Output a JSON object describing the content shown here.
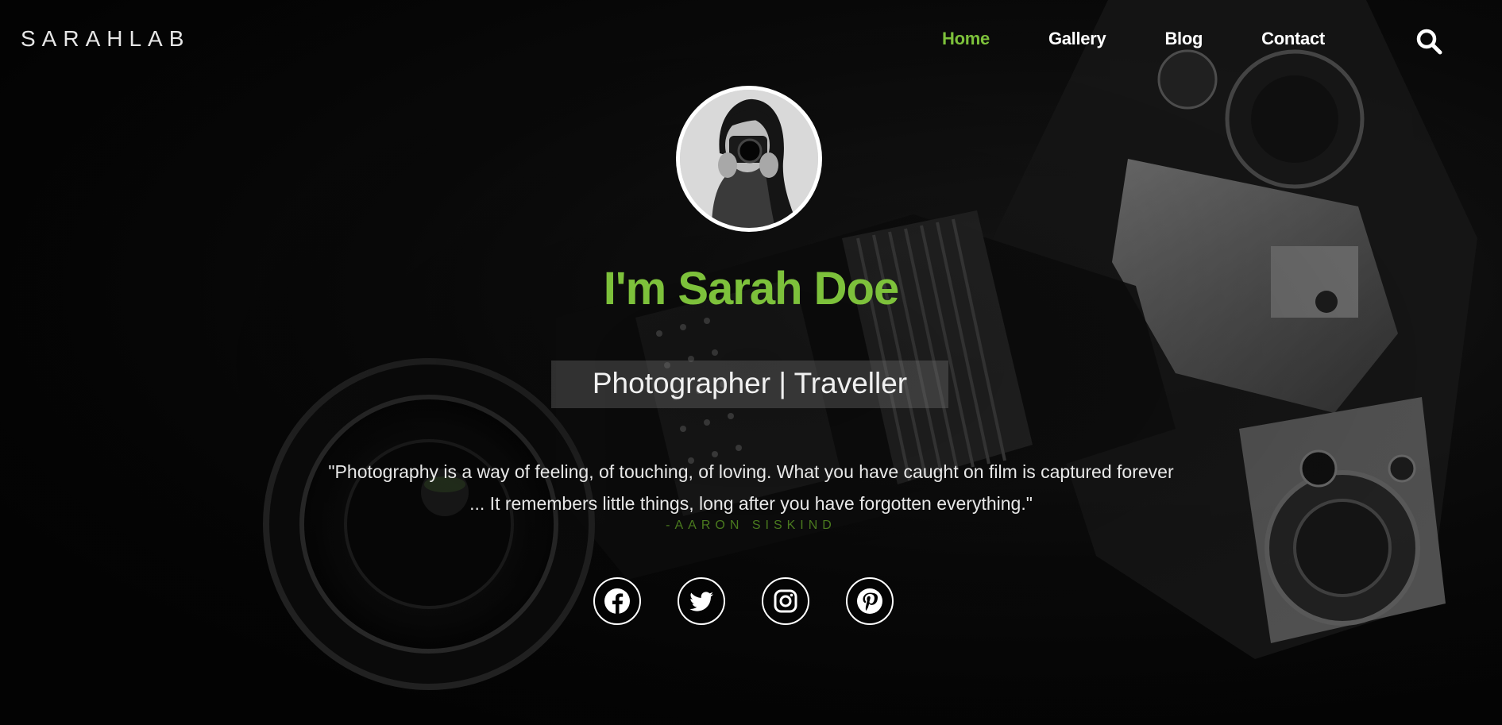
{
  "brand": {
    "logo_text": "SARAHLAB"
  },
  "nav": {
    "items": [
      {
        "label": "Home",
        "active": true
      },
      {
        "label": "Gallery",
        "active": false
      },
      {
        "label": "Blog",
        "active": false
      },
      {
        "label": "Contact",
        "active": false
      }
    ],
    "search_icon": "search-icon"
  },
  "hero": {
    "title": "I'm Sarah Doe",
    "subtitle": "Photographer | Traveller",
    "quote_line1": "\"Photography is a way of feeling, of touching, of loving. What you have caught on film is captured forever",
    "quote_line2": "... It remembers little things, long after you have forgotten everything.\"",
    "author": "-AARON SISKIND"
  },
  "social": [
    {
      "icon": "facebook-icon"
    },
    {
      "icon": "twitter-icon"
    },
    {
      "icon": "instagram-icon"
    },
    {
      "icon": "pinterest-icon"
    }
  ],
  "colors": {
    "accent": "#7dc13b",
    "author": "#4a7a1e",
    "background": "#030303",
    "text": "#ffffff"
  }
}
